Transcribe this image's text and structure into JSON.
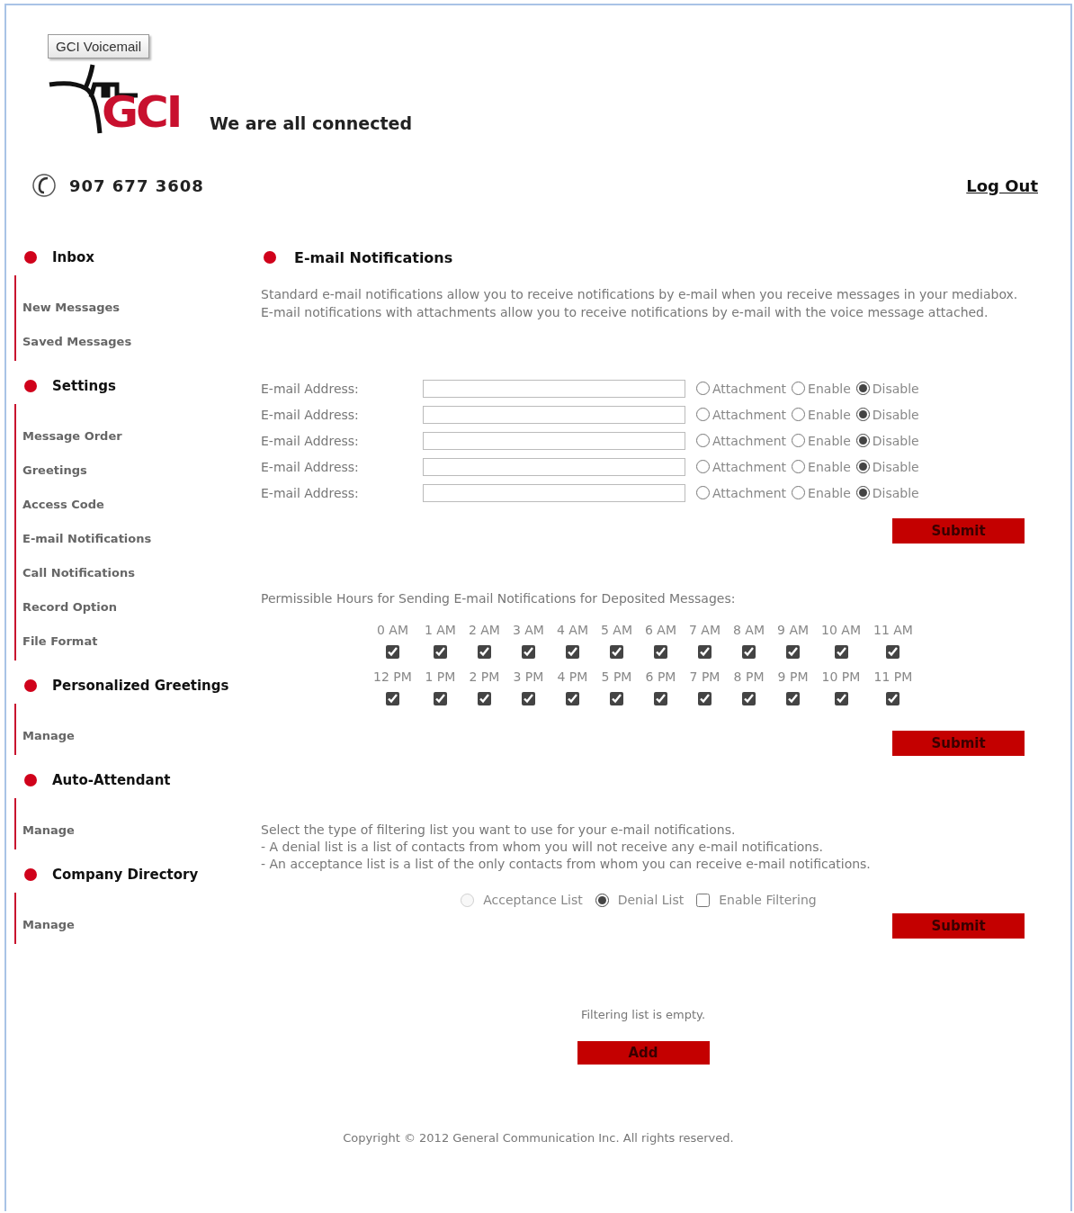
{
  "tooltip": "GCI Voicemail",
  "logo": {
    "text": "GCI",
    "tagline": "We are all connected"
  },
  "phone": "907 677 3608",
  "logout": "Log Out",
  "sidebar": {
    "sections": [
      {
        "title": "Inbox",
        "items": [
          "New Messages",
          "Saved Messages"
        ]
      },
      {
        "title": "Settings",
        "items": [
          "Message Order",
          "Greetings",
          "Access Code",
          "E-mail Notifications",
          "Call Notifications",
          "Record Option",
          "File Format"
        ]
      },
      {
        "title": "Personalized Greetings",
        "items": [
          "Manage"
        ]
      },
      {
        "title": "Auto-Attendant",
        "items": [
          "Manage"
        ]
      },
      {
        "title": "Company Directory",
        "items": [
          "Manage"
        ]
      }
    ]
  },
  "main": {
    "title": "E-mail Notifications",
    "intro": "Standard e-mail notifications allow you to receive notifications by e-mail when you receive messages in your mediabox. E-mail notifications with attachments allow you to receive notifications by e-mail with the voice message attached.",
    "email_rows": [
      {
        "label": "E-mail Address:",
        "options": [
          {
            "label": "Attachment",
            "selected": false
          },
          {
            "label": "Enable",
            "selected": false
          },
          {
            "label": "Disable",
            "selected": true
          }
        ]
      },
      {
        "label": "E-mail Address:",
        "options": [
          {
            "label": "Attachment",
            "selected": false
          },
          {
            "label": "Enable",
            "selected": false
          },
          {
            "label": "Disable",
            "selected": true
          }
        ]
      },
      {
        "label": "E-mail Address:",
        "options": [
          {
            "label": "Attachment",
            "selected": false
          },
          {
            "label": "Enable",
            "selected": false
          },
          {
            "label": "Disable",
            "selected": true
          }
        ]
      },
      {
        "label": "E-mail Address:",
        "options": [
          {
            "label": "Attachment",
            "selected": false
          },
          {
            "label": "Enable",
            "selected": false
          },
          {
            "label": "Disable",
            "selected": true
          }
        ]
      },
      {
        "label": "E-mail Address:",
        "options": [
          {
            "label": "Attachment",
            "selected": false
          },
          {
            "label": "Enable",
            "selected": false
          },
          {
            "label": "Disable",
            "selected": true
          }
        ]
      }
    ],
    "email_submit": "Submit",
    "hours_label": "Permissible Hours for Sending E-mail Notifications for Deposited Messages:",
    "hours": [
      {
        "label": "0 AM",
        "checked": true
      },
      {
        "label": "1 AM",
        "checked": true
      },
      {
        "label": "2 AM",
        "checked": true
      },
      {
        "label": "3 AM",
        "checked": true
      },
      {
        "label": "4 AM",
        "checked": true
      },
      {
        "label": "5 AM",
        "checked": true
      },
      {
        "label": "6 AM",
        "checked": true
      },
      {
        "label": "7 AM",
        "checked": true
      },
      {
        "label": "8 AM",
        "checked": true
      },
      {
        "label": "9 AM",
        "checked": true
      },
      {
        "label": "10 AM",
        "checked": true
      },
      {
        "label": "11 AM",
        "checked": true
      },
      {
        "label": "12 PM",
        "checked": true
      },
      {
        "label": "1 PM",
        "checked": true
      },
      {
        "label": "2 PM",
        "checked": true
      },
      {
        "label": "3 PM",
        "checked": true
      },
      {
        "label": "4 PM",
        "checked": true
      },
      {
        "label": "5 PM",
        "checked": true
      },
      {
        "label": "6 PM",
        "checked": true
      },
      {
        "label": "7 PM",
        "checked": true
      },
      {
        "label": "8 PM",
        "checked": true
      },
      {
        "label": "9 PM",
        "checked": true
      },
      {
        "label": "10 PM",
        "checked": true
      },
      {
        "label": "11 PM",
        "checked": true
      }
    ],
    "hours_submit": "Submit",
    "filter_lines": [
      "Select the type of filtering list you want to use for your e-mail notifications.",
      "- A denial list is a list of contacts from whom you will not receive any e-mail notifications.",
      "- An acceptance list is a list of the only contacts from whom you can receive e-mail notifications."
    ],
    "filter_options": [
      {
        "kind": "radio",
        "label": "Acceptance List",
        "selected": false,
        "disabled": true
      },
      {
        "kind": "radio",
        "label": "Denial List",
        "selected": true,
        "disabled": false
      },
      {
        "kind": "checkbox",
        "label": "Enable Filtering",
        "checked": false
      }
    ],
    "filter_submit": "Submit",
    "empty_message": "Filtering list is empty.",
    "add_button": "Add"
  },
  "copyright": "Copyright © 2012 General Communication Inc. All rights reserved."
}
